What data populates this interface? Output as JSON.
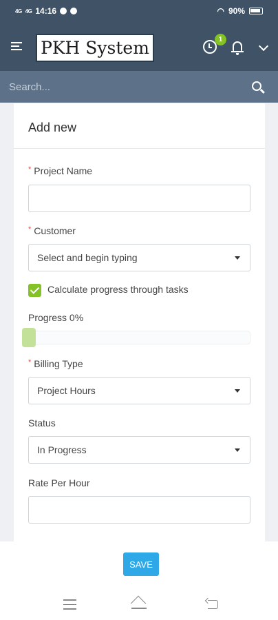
{
  "status_bar": {
    "time": "14:16",
    "signal_1": "4G",
    "signal_2": "4G",
    "battery": "90%"
  },
  "header": {
    "logo_text": "PKH System",
    "notification_count": "1"
  },
  "search": {
    "placeholder": "Search..."
  },
  "form": {
    "title": "Add new",
    "project_name": {
      "label": "Project Name",
      "required_mark": "*",
      "value": ""
    },
    "customer": {
      "label": "Customer",
      "required_mark": "*",
      "value": "Select and begin typing"
    },
    "calculate_progress": {
      "label": "Calculate progress through tasks",
      "checked": true
    },
    "progress": {
      "label": "Progress 0%",
      "value_percent": 0
    },
    "billing_type": {
      "label": "Billing Type",
      "required_mark": "*",
      "value": "Project Hours"
    },
    "status": {
      "label": "Status",
      "value": "In Progress"
    },
    "rate_per_hour": {
      "label": "Rate Per Hour",
      "value": ""
    }
  },
  "footer": {
    "save_label": "SAVE"
  },
  "colors": {
    "header": "#3f5266",
    "search_bar": "#5d7188",
    "accent_green": "#84c225",
    "save_blue": "#2ea8e6",
    "required_red": "#e74c3c"
  }
}
